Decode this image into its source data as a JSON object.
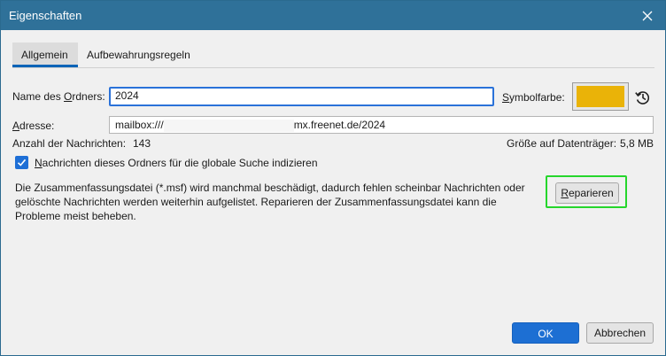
{
  "window": {
    "title": "Eigenschaften"
  },
  "tabs": [
    {
      "label": "Allgemein",
      "active": true
    },
    {
      "label": "Aufbewahrungsregeln",
      "active": false
    }
  ],
  "folder_name": {
    "label": "Name des Ordners:",
    "label_underline": "O",
    "value": "2024"
  },
  "symbol_color": {
    "label": "Symbolfarbe:",
    "color": "#eab308"
  },
  "address": {
    "label": "Adresse:",
    "value_prefix": "mailbox:///",
    "value_suffix": "mx.freenet.de/2024"
  },
  "message_count": {
    "label": "Anzahl der Nachrichten:",
    "value": "143"
  },
  "disk_size": {
    "label": "Größe auf Datenträger:",
    "value": "5,8 MB"
  },
  "index_option": {
    "label": "Nachrichten dieses Ordners für die globale Suche indizieren",
    "checked": true
  },
  "repair_description": "Die Zusammenfassungsdatei (*.msf) wird manchmal beschädigt, dadurch fehlen scheinbar Nachrichten oder gelöschte Nachrichten werden weiterhin aufgelistet. Reparieren der Zusammenfassungsdatei kann die Probleme meist beheben.",
  "buttons": {
    "repair": "Reparieren",
    "ok": "OK",
    "cancel": "Abbrechen"
  },
  "colors": {
    "titlebar": "#2f7199",
    "accent": "#1d6fd3",
    "highlight": "#25d62c"
  }
}
